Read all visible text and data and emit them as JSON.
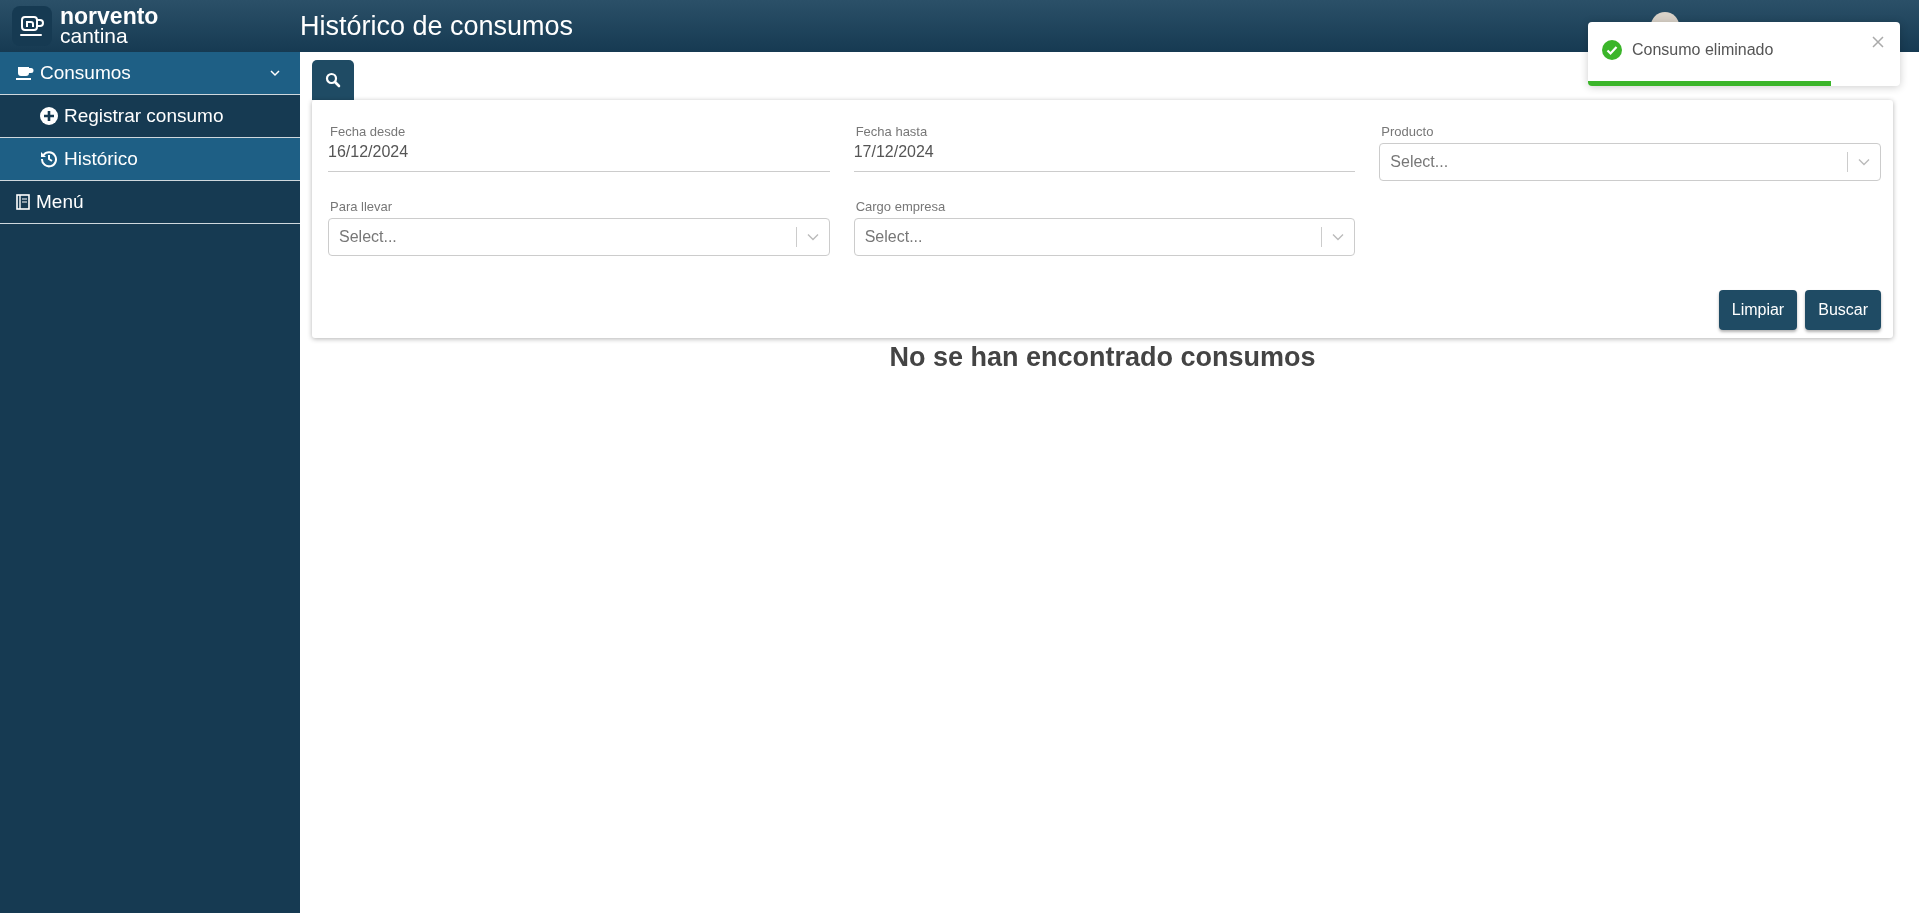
{
  "brand": {
    "name": "norvento",
    "sub": "cantina"
  },
  "page_title": "Histórico de consumos",
  "sidebar": {
    "items": [
      {
        "label": "Consumos",
        "kind": "cup",
        "selected": true,
        "expanded": true,
        "children": [
          {
            "label": "Registrar consumo",
            "kind": "plus",
            "selected": false
          },
          {
            "label": "Histórico",
            "kind": "history",
            "selected": true
          }
        ]
      },
      {
        "label": "Menú",
        "kind": "book",
        "selected": false
      }
    ]
  },
  "filters": [
    {
      "kind": "date",
      "label": "Fecha desde",
      "value": "16/12/2024"
    },
    {
      "kind": "date",
      "label": "Fecha hasta",
      "value": "17/12/2024"
    },
    {
      "kind": "select",
      "label": "Producto",
      "placeholder": "Select..."
    },
    {
      "kind": "select",
      "label": "Para llevar",
      "placeholder": "Select..."
    },
    {
      "kind": "select",
      "label": "Cargo empresa",
      "placeholder": "Select..."
    }
  ],
  "buttons": [
    "Limpiar",
    "Buscar"
  ],
  "empty_message": "No se han encontrado consumos",
  "toast": {
    "message": "Consumo eliminado",
    "level": 0.78
  }
}
